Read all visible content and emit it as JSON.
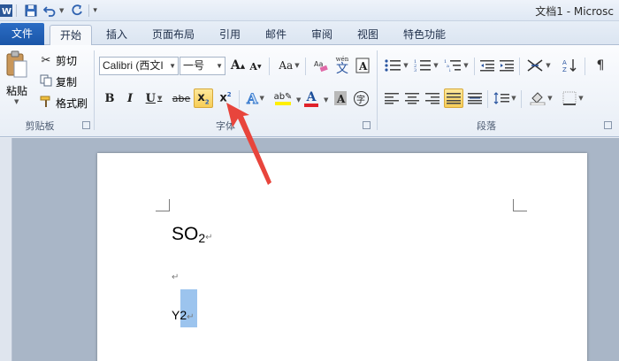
{
  "window": {
    "title": "文档1 - Microsc"
  },
  "tabs": {
    "file": "文件",
    "home": "开始",
    "insert": "插入",
    "page_layout": "页面布局",
    "references": "引用",
    "mailings": "邮件",
    "review": "审阅",
    "view": "视图",
    "special": "特色功能"
  },
  "clipboard": {
    "paste": "粘贴",
    "cut": "剪切",
    "copy": "复制",
    "format_painter": "格式刷",
    "group_label": "剪贴板"
  },
  "font": {
    "name": "Calibri (西文I",
    "size": "一号",
    "bold": "B",
    "italic": "I",
    "underline": "U",
    "strike": "abe",
    "subscript_active": true,
    "group_label": "字体",
    "phonetic_glyph": "wén",
    "phonetic_char": "文",
    "aa": "Aa",
    "enclose_char": "字",
    "font_color": "#e0222a",
    "highlight_color": "#ffef00"
  },
  "paragraph": {
    "group_label": "段落"
  },
  "document": {
    "line1_main": "SO",
    "line1_sub": "2",
    "line3": "Y2"
  },
  "annotation": {
    "arrow_color": "#e8453c"
  }
}
